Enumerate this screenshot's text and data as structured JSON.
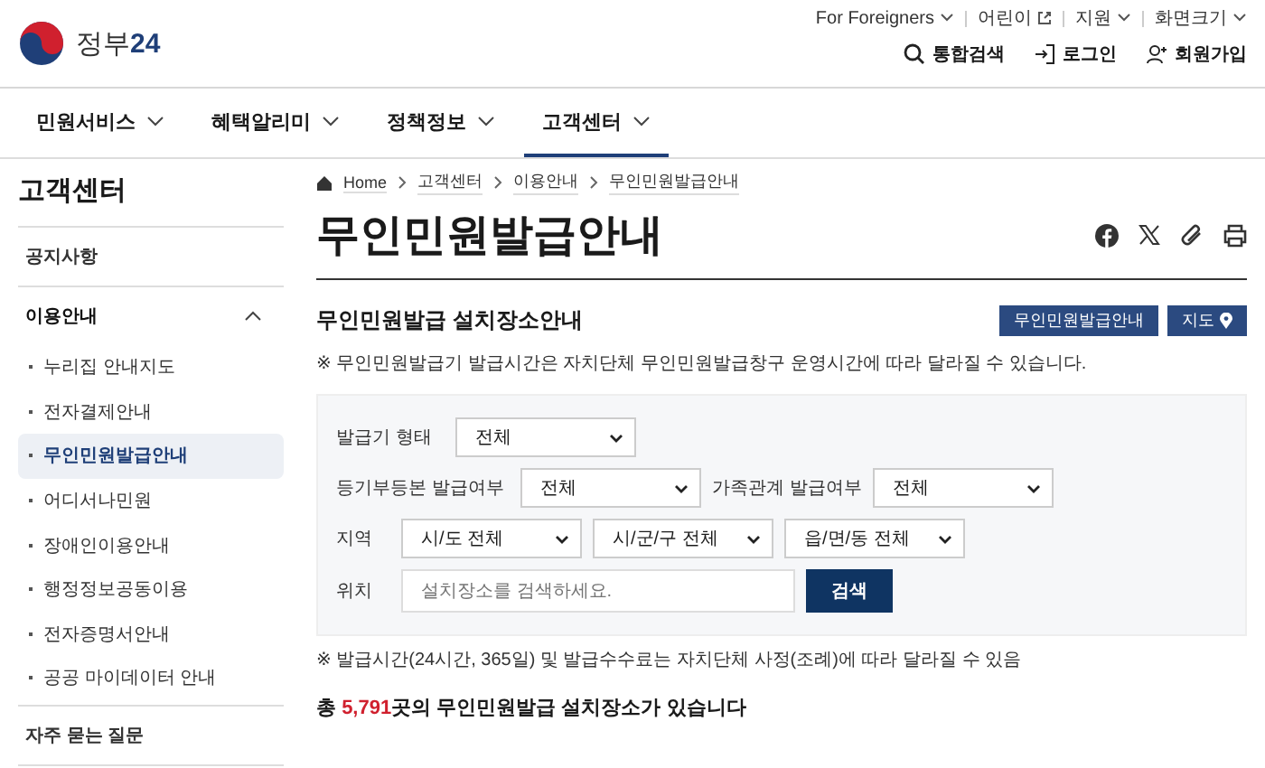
{
  "header": {
    "logo_text": "정부",
    "logo_number": "24",
    "utility_links": [
      {
        "label": "For Foreigners",
        "kind": "dropdown"
      },
      {
        "label": "어린이",
        "kind": "external"
      },
      {
        "label": "지원",
        "kind": "dropdown"
      },
      {
        "label": "화면크기",
        "kind": "dropdown"
      }
    ],
    "actions": [
      {
        "label": "통합검색",
        "kind": "search"
      },
      {
        "label": "로그인",
        "kind": "login"
      },
      {
        "label": "회원가입",
        "kind": "signup"
      }
    ]
  },
  "nav": [
    {
      "label": "민원서비스",
      "selected": false
    },
    {
      "label": "혜택알리미",
      "selected": false
    },
    {
      "label": "정책정보",
      "selected": false
    },
    {
      "label": "고객센터",
      "selected": true
    }
  ],
  "sidebar": {
    "title": "고객센터",
    "items": [
      {
        "label": "공지사항"
      },
      {
        "label": "이용안내",
        "expanded": true,
        "children": [
          {
            "label": "누리집 안내지도",
            "selected": false
          },
          {
            "label": "전자결제안내",
            "selected": false
          },
          {
            "label": "무인민원발급안내",
            "selected": true
          },
          {
            "label": "어디서나민원",
            "selected": false
          },
          {
            "label": "장애인이용안내",
            "selected": false
          },
          {
            "label": "행정정보공동이용",
            "selected": false
          },
          {
            "label": "전자증명서안내",
            "selected": false
          },
          {
            "label": "공공 마이데이터 안내",
            "selected": false
          }
        ]
      },
      {
        "label": "자주 묻는 질문"
      }
    ]
  },
  "breadcrumb": [
    "Home",
    "고객센터",
    "이용안내",
    "무인민원발급안내"
  ],
  "page_title": "무인민원발급안내",
  "section": {
    "title": "무인민원발급 설치장소안내",
    "buttons": [
      {
        "label": "무인민원발급안내",
        "kind": "plain"
      },
      {
        "label": "지도",
        "kind": "map"
      }
    ],
    "notice": "※ 무인민원발급기 발급시간은 자치단체 무인민원발급창구 운영시간에 따라 달라질 수 있습니다."
  },
  "form": {
    "rows": [
      [
        {
          "kind": "label",
          "text": "발급기 형태"
        },
        {
          "kind": "select",
          "value": "전체"
        }
      ],
      [
        {
          "kind": "label",
          "text": "등기부등본 발급여부"
        },
        {
          "kind": "select",
          "value": "전체"
        },
        {
          "kind": "label",
          "text": "가족관계 발급여부"
        },
        {
          "kind": "select",
          "value": "전체"
        }
      ],
      [
        {
          "kind": "label",
          "text": "지역"
        },
        {
          "kind": "select",
          "value": "시/도 전체"
        },
        {
          "kind": "select",
          "value": "시/군/구 전체"
        },
        {
          "kind": "select",
          "value": "읍/면/동 전체"
        }
      ],
      [
        {
          "kind": "label",
          "text": "위치"
        },
        {
          "kind": "input",
          "placeholder": "설치장소를 검색하세요."
        },
        {
          "kind": "button",
          "text": "검색"
        }
      ]
    ]
  },
  "footnote": "※ 발급시간(24시간, 365일) 및 발급수수료는 자치단체 사정(조례)에 따라 달라질 수 있음",
  "total": {
    "prefix": "총",
    "count": "5,791",
    "suffix": "곳의 무인민원발급 설치장소가 있습니다"
  }
}
